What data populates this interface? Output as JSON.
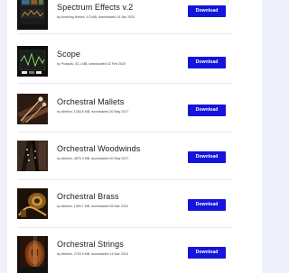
{
  "packs": [
    {
      "title": "Spectrum Effects v.2",
      "meta": "by Amazing Noises, 9.3 MB, downloaded 16 Jan 2020",
      "download_label": "Download",
      "thumb_icon": "spectrum-effects-thumbnail-icon"
    },
    {
      "title": "Scope",
      "meta": "by Plotpark, 33.1 MB, downloaded 02 Feb 2020",
      "download_label": "Download",
      "thumb_icon": "scope-thumbnail-icon"
    },
    {
      "title": "Orchestral Mallets",
      "meta": "by Ableton, 1283.6 MB, downloaded 20 May 2017",
      "download_label": "Download",
      "thumb_icon": "mallets-thumbnail-icon"
    },
    {
      "title": "Orchestral Woodwinds",
      "meta": "by Ableton, 4675.3 MB, downloaded 20 May 2017",
      "download_label": "Download",
      "thumb_icon": "woodwinds-thumbnail-icon"
    },
    {
      "title": "Orchestral Brass",
      "meta": "by Ableton, 1490.7 MB, downloaded 06 Mar 2024",
      "download_label": "Download",
      "thumb_icon": "brass-thumbnail-icon"
    },
    {
      "title": "Orchestral Strings",
      "meta": "by Ableton, 2793.9 MB, downloaded 14 Mar 2015",
      "download_label": "Download",
      "thumb_icon": "strings-thumbnail-icon"
    }
  ],
  "colors": {
    "page_background": "#eef0fb",
    "panel_background": "#ffffff",
    "button_background": "#1414dc",
    "button_text": "#ffffff",
    "title_text": "#1a1a1a"
  }
}
